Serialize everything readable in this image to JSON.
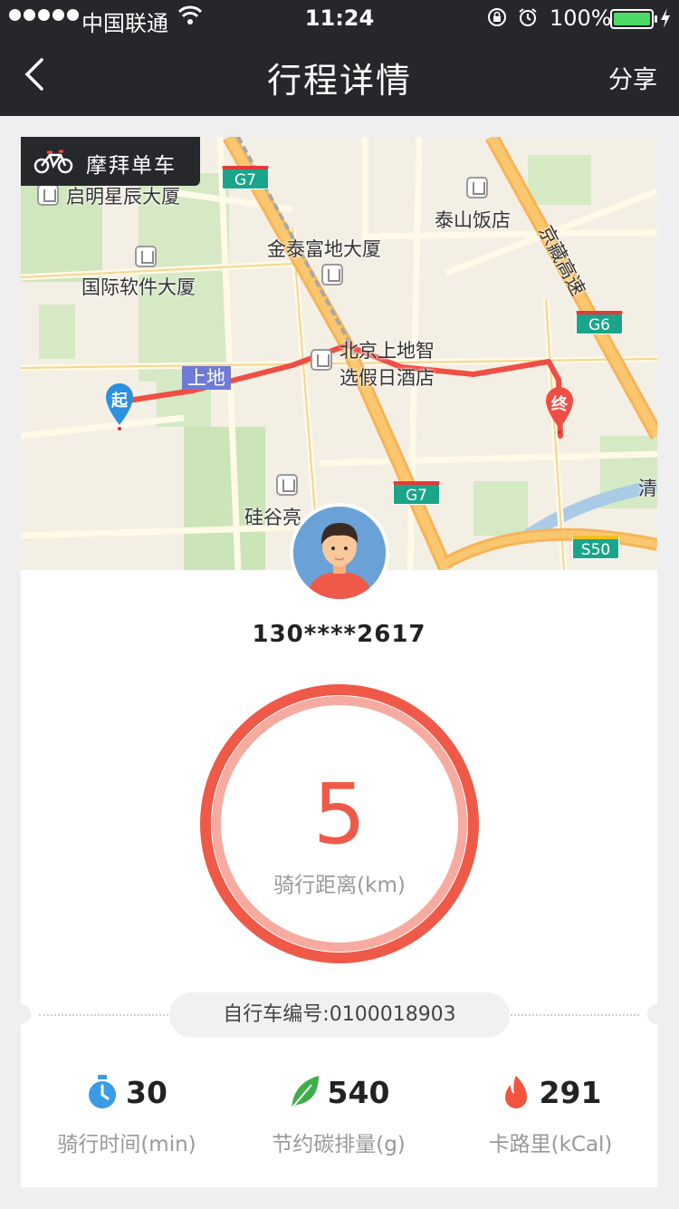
{
  "status_bar": {
    "carrier": "中国联通",
    "time": "11:24",
    "battery": "100%"
  },
  "nav": {
    "title": "行程详情",
    "share_label": "分享"
  },
  "map": {
    "brand": "摩拜单车",
    "start_marker": "起",
    "end_marker": "终",
    "area_tag": "上地",
    "places": [
      "启明星辰大厦",
      "泰山饭店",
      "金泰富地大厦",
      "国际软件大厦",
      "北京上地智",
      "选假日酒店",
      "硅谷亮",
      "清",
      "京藏高速"
    ],
    "shields": [
      "G7",
      "G6",
      "G7",
      "S50"
    ]
  },
  "user": {
    "phone": "130****2617"
  },
  "ride": {
    "distance": "5",
    "distance_label": "骑行距离(km)",
    "bike_number": "自行车编号:0100018903"
  },
  "stats": [
    {
      "value": "30",
      "label": "骑行时间(min)",
      "icon": "stopwatch-icon"
    },
    {
      "value": "540",
      "label": "节约碳排量(g)",
      "icon": "leaf-icon"
    },
    {
      "value": "291",
      "label": "卡路里(kCal)",
      "icon": "flame-icon"
    }
  ],
  "colors": {
    "header_bg": "#25272b",
    "accent_red": "#ef5a48",
    "stopwatch_blue": "#3a9be6",
    "leaf_green": "#3fae4a",
    "flame_red": "#f0553e"
  }
}
